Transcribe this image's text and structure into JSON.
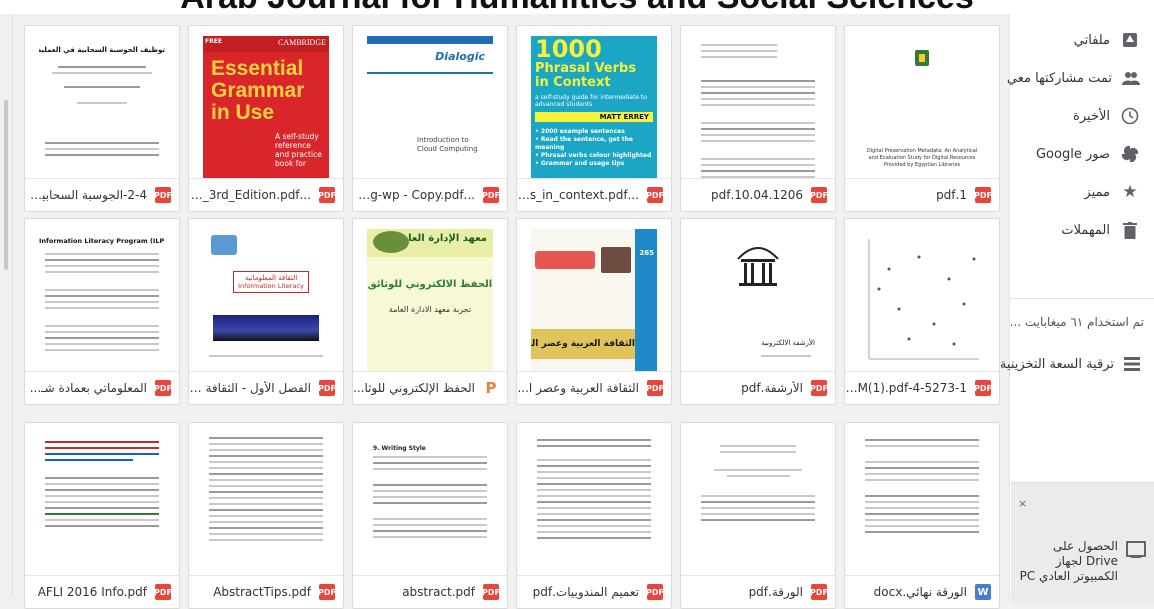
{
  "page": {
    "title": "Arab Journal for Humanities and Social Sciences"
  },
  "sidebar": {
    "items": [
      {
        "label": "ملفاتي",
        "icon": "drive-icon"
      },
      {
        "label": "تمت مشاركتها معي",
        "icon": "people-icon"
      },
      {
        "label": "الأخيرة",
        "icon": "clock-icon"
      },
      {
        "label": "صور Google",
        "icon": "photos-icon"
      },
      {
        "label": "مميز",
        "icon": "star-icon"
      },
      {
        "label": "المهملات",
        "icon": "trash-icon"
      }
    ],
    "storage_text": "تم استخدام ٦١ ميغابايت ...",
    "upgrade_label": "ترقية السعة التخزينية",
    "promo": {
      "text": "الحصول على Drive لجهاز الكمبيوتر العادي PC",
      "close": "×"
    }
  },
  "files": [
    {
      "name": "2-4-الجوسبة السحابية ...",
      "type": "PDF",
      "preview": {
        "title": "توظيف الحوسبة السحابية في العملية التعليمية"
      }
    },
    {
      "name": "...se_-_3rd_Edition.pdf",
      "type": "PDF",
      "preview": {
        "brand": "CAMBRIDGE",
        "badge": "FREE",
        "title": "Essential Grammar in Use",
        "sub": "A self-study reference and practice book for"
      }
    },
    {
      "name": "...puting-wp - Copy.pdf",
      "type": "PDF",
      "preview": {
        "brand": "Dialogic",
        "title": "Introduction to Cloud Computing"
      }
    },
    {
      "name": "...verbs_in_context.pdf",
      "type": "PDF",
      "preview": {
        "big": "1000",
        "title": "Phrasal Verbs in Context",
        "sub": "a self-study guide for intermediate to advanced students",
        "author": "MATT ERREY",
        "bullets": [
          "• 2000 example sentences",
          "• Read the sentence, get the meaning",
          "• Phrasal verbs colour highlighted",
          "• Grammar and usage tips"
        ]
      }
    },
    {
      "name": "10.04.1206.pdf",
      "type": "PDF",
      "preview": {}
    },
    {
      "name": "1.pdf",
      "type": "PDF",
      "preview": {
        "caption": "Digital Preservation Metadata: An Analytical and Evaluation Study for Digital Resources Provided by Egyptian Libraries"
      }
    },
    {
      "name": "المعلوماتي بعمادة شـ...",
      "type": "PDF",
      "preview": {
        "title": "Information Literacy Program (ILP)"
      }
    },
    {
      "name": "الفصل الأول - الثقافة ا...",
      "type": "PDF",
      "preview": {
        "title": "الثقافة المعلوماتية",
        "sub": "Information Literacy"
      }
    },
    {
      "name": "الحفظ الإلكتروني للوثا...",
      "type": "P",
      "preview": {
        "title": "الحفظ الالكتروني للوثائق",
        "sub": "تجربة معهد الادارة العامة",
        "header": "معهد الإدارة العامة"
      }
    },
    {
      "name": "الثقافة العربية وعصر ا...",
      "type": "PDF",
      "preview": {
        "title": "الثقافة العربية وعصر المعلومات",
        "num": "265"
      }
    },
    {
      "name": "الأرشفة.pdf",
      "type": "PDF",
      "preview": {
        "title": "الأرشفة الالكترونية"
      }
    },
    {
      "name": "4-5273-1-SM(1).pdf...",
      "type": "PDF",
      "preview": {}
    },
    {
      "name": "AFLI 2016 Info.pdf",
      "type": "PDF",
      "preview": {}
    },
    {
      "name": "AbstractTips.pdf",
      "type": "PDF",
      "preview": {}
    },
    {
      "name": "abstract.pdf",
      "type": "PDF",
      "preview": {
        "title": "9. Writing Style"
      }
    },
    {
      "name": "تعميم المندوبيات.pdf",
      "type": "PDF",
      "preview": {}
    },
    {
      "name": "الورقة.pdf",
      "type": "PDF",
      "preview": {}
    },
    {
      "name": "الورقة نهائي.docx",
      "type": "W",
      "preview": {}
    }
  ]
}
